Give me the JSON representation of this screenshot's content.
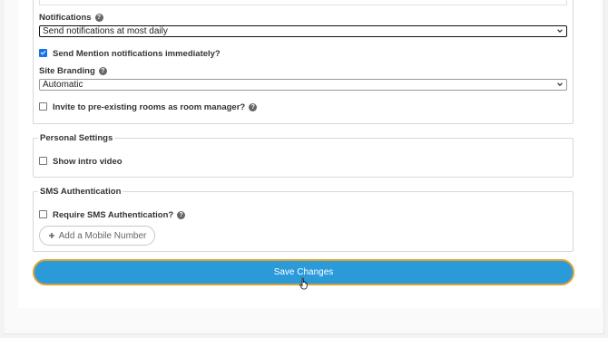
{
  "notifications": {
    "label": "Notifications",
    "selected": "Send notifications at most daily",
    "mention_checkbox": {
      "label": "Send Mention notifications immediately?",
      "checked": true
    }
  },
  "site_branding": {
    "label": "Site Branding",
    "selected": "Automatic"
  },
  "invite_checkbox": {
    "label": "Invite to pre-existing rooms as room manager?",
    "checked": false
  },
  "personal_settings": {
    "legend": "Personal Settings",
    "show_intro_video": {
      "label": "Show intro video",
      "checked": false
    }
  },
  "sms_authentication": {
    "legend": "SMS Authentication",
    "require_sms": {
      "label": "Require SMS Authentication?",
      "checked": false
    },
    "add_mobile_label": "Add a Mobile Number"
  },
  "save_button_label": "Save Changes",
  "colors": {
    "primary": "#2b9ad9",
    "focus_ring": "#d9a235",
    "checkbox_checked": "#1a73e8"
  }
}
